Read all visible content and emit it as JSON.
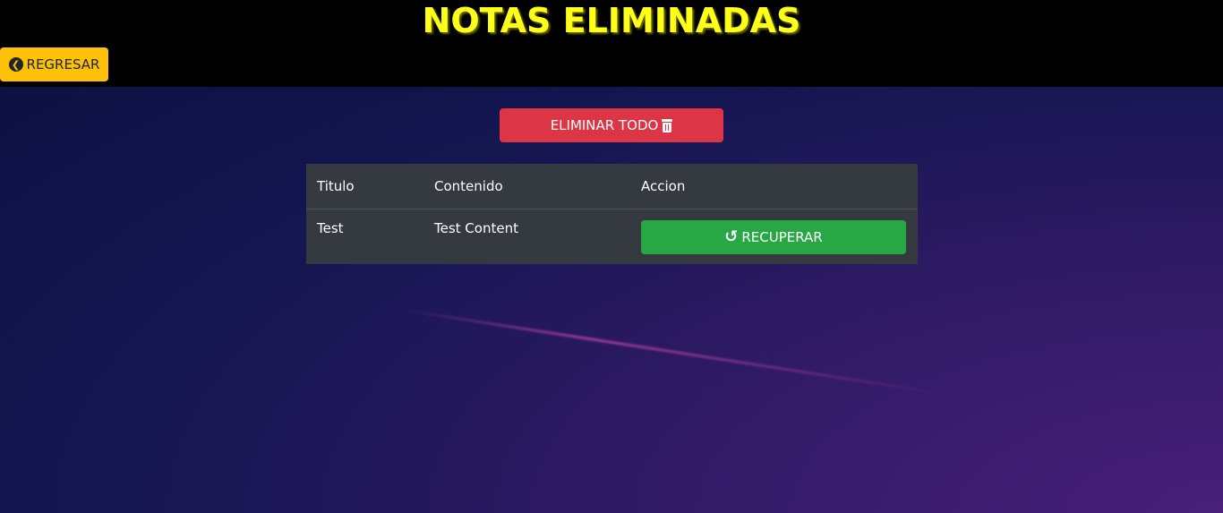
{
  "header": {
    "title": "NOTAS ELIMINADAS",
    "back_label": "REGRESAR",
    "back_icon": "arrow-circle-left-icon"
  },
  "toolbar": {
    "delete_all_label": "ELIMINAR TODO",
    "delete_all_icon": "trash-icon"
  },
  "table": {
    "headers": [
      "Titulo",
      "Contenido",
      "Accion"
    ],
    "rows": [
      {
        "title": "Test",
        "content": "Test Content",
        "action_label": "RECUPERAR",
        "action_icon": "undo-icon"
      }
    ]
  },
  "colors": {
    "title": "#ffff1a",
    "back_button": "#ffc107",
    "delete_button": "#dc3545",
    "recover_button": "#28a745",
    "table_bg": "#343a40"
  }
}
